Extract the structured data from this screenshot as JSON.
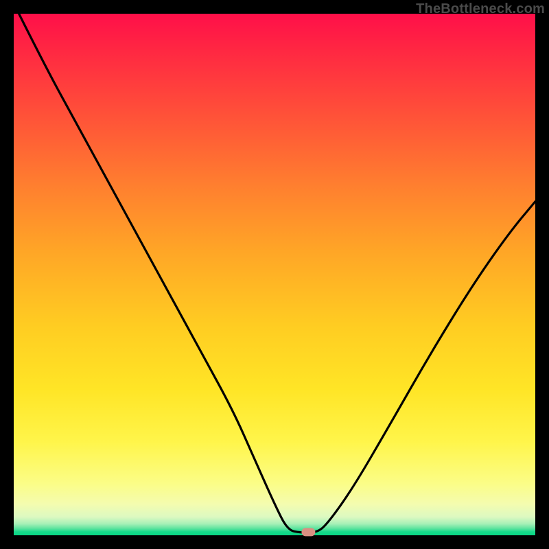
{
  "watermark": "TheBottleneck.com",
  "colors": {
    "frame": "#000000",
    "curve_stroke": "#000000",
    "marker": "#d98f82"
  },
  "chart_data": {
    "type": "line",
    "title": "",
    "xlabel": "",
    "ylabel": "",
    "xlim": [
      0,
      100
    ],
    "ylim": [
      0,
      100
    ],
    "note": "Axes are unlabeled in the source image; coordinates below are normalized 0–100 within the gradient plot area; y=0 is bottom (green band), y=100 is top (red).",
    "series": [
      {
        "name": "bottleneck-curve",
        "x": [
          1,
          6,
          12,
          18,
          24,
          30,
          36,
          42,
          46,
          50,
          52.5,
          55,
          58,
          60,
          65,
          72,
          80,
          88,
          95,
          100
        ],
        "y": [
          100,
          90,
          79,
          68,
          57,
          46,
          35,
          24,
          15,
          6,
          1,
          0.5,
          0.5,
          2,
          9,
          21,
          35,
          48,
          58,
          64
        ]
      }
    ],
    "marker": {
      "x": 56.5,
      "y": 0.6,
      "shape": "pill"
    }
  }
}
